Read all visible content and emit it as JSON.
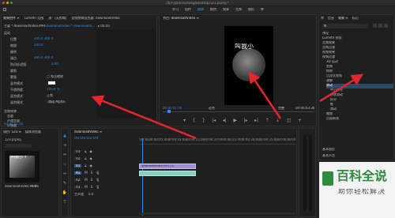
{
  "title_bar": {
    "title": "/用户/yamenzhang/Desktop/123.prproj *"
  },
  "workspace_tabs": [
    "学习",
    "组件",
    "编辑",
    "颜色",
    "效果",
    "音频",
    "图形",
    "库"
  ],
  "left_tabs": [
    "效果控件 ≡",
    "Lumetri 范围",
    "源：(无剪辑)",
    "音频剪辑混合器: downloadVideo"
  ],
  "effect_controls": {
    "source_label": "主要 * downloadVideo.MP4",
    "clip_label": "downloadVideo * downloadVi...",
    "timecode_marker": "▸:00:00",
    "rows": [
      {
        "label": "运动",
        "value": ""
      },
      {
        "label": "位置",
        "value": "360.0    360.0"
      },
      {
        "label": "缩放",
        "value": "100.0"
      },
      {
        "label": "旋转",
        "value": ""
      },
      {
        "label": "锚点",
        "value": "360.0    360.0"
      },
      {
        "label": "防闪烁滤镜",
        "value": "0.00"
      },
      {
        "label": "裁剪",
        "value": ""
      },
      {
        "label": "蒙版",
        "value": "□ 等比缩放"
      },
      {
        "label": "混合模式",
        "value": "100.0 %"
      },
      {
        "label": "不透明度",
        "value": "100.0 %"
      },
      {
        "label": "混合模式",
        "value": "正常"
      },
      {
        "label": "混合模式",
        "value": "滑动 Alpha"
      }
    ],
    "section_labels": [
      "音频效果",
      "音量",
      "声道音量",
      "声像器"
    ],
    "timecode": "00:00:01:00"
  },
  "program_monitor": {
    "tab": "节目: downloadVideo ≡",
    "video_caption": "叫我小",
    "timecode_left": "00:00:01:00",
    "fit": "适合",
    "quality": "完整",
    "timecode_right": "00:00:03:36"
  },
  "effects_panel": {
    "tabs": [
      "库",
      "信息",
      "效果 ≡",
      "标记"
    ],
    "search_placeholder": "",
    "items": [
      {
        "label": "预设",
        "indent": 0
      },
      {
        "label": "Lumetri 预设",
        "indent": 0
      },
      {
        "label": "音频效果",
        "indent": 0
      },
      {
        "label": "音频过渡",
        "indent": 0
      },
      {
        "label": "视频效果",
        "indent": 0
      },
      {
        "label": "视频过渡",
        "indent": 0
      },
      {
        "label": "3D 运动",
        "indent": 1
      },
      {
        "label": "划像",
        "indent": 1
      },
      {
        "label": "擦除",
        "indent": 1
      },
      {
        "label": "沉浸式视频",
        "indent": 1
      },
      {
        "label": "溶解",
        "indent": 1
      },
      {
        "label": "滑动",
        "indent": 1
      },
      {
        "label": "中心拆分",
        "indent": 2
      },
      {
        "label": "带状滑动",
        "indent": 2
      },
      {
        "label": "拆分",
        "indent": 2
      },
      {
        "label": "推",
        "indent": 2
      },
      {
        "label": "滑动",
        "indent": 2
      },
      {
        "label": "缩放",
        "indent": 1
      },
      {
        "label": "页面剥落",
        "indent": 1
      }
    ],
    "basic_graphics": [
      "基本图形",
      "基本声音"
    ]
  },
  "project_panel": {
    "tabs": [
      "项目: 123 ≡",
      "媒体浏览器"
    ],
    "project_name": "123.prproj",
    "clip_name": "downloadVideo.MP4",
    "clip_duration": "3:36",
    "clip_caption": "叫我小 Y"
  },
  "timeline": {
    "tab": "downloadVideo ≡",
    "timecode": "00:00:01:00",
    "ruler": [
      ":00:00",
      "00:00:05:00",
      "00:00:10:00",
      "00:00:15:00",
      "00:00:20:00",
      "00:00:25:00",
      "00:00:30:00",
      "00:00:35:00",
      "00:00:40:00",
      "00:00:45:00"
    ],
    "tracks": [
      "V3",
      "V2",
      "V1",
      "A1",
      "A2",
      "A3"
    ],
    "master": "主声道",
    "master_value": "0.0",
    "video_clip": "downloadVideo.MP4 [V]",
    "audio_clip": ""
  },
  "watermark": {
    "title": "百科全说",
    "subtitle": "助你轻松解决"
  },
  "colors": {
    "accent": "#2d8ceb",
    "arrow": "#e5262b",
    "clip_video": "#9f8fd6",
    "clip_audio": "#8ad0bf",
    "watermark": "#2e8a3e"
  }
}
